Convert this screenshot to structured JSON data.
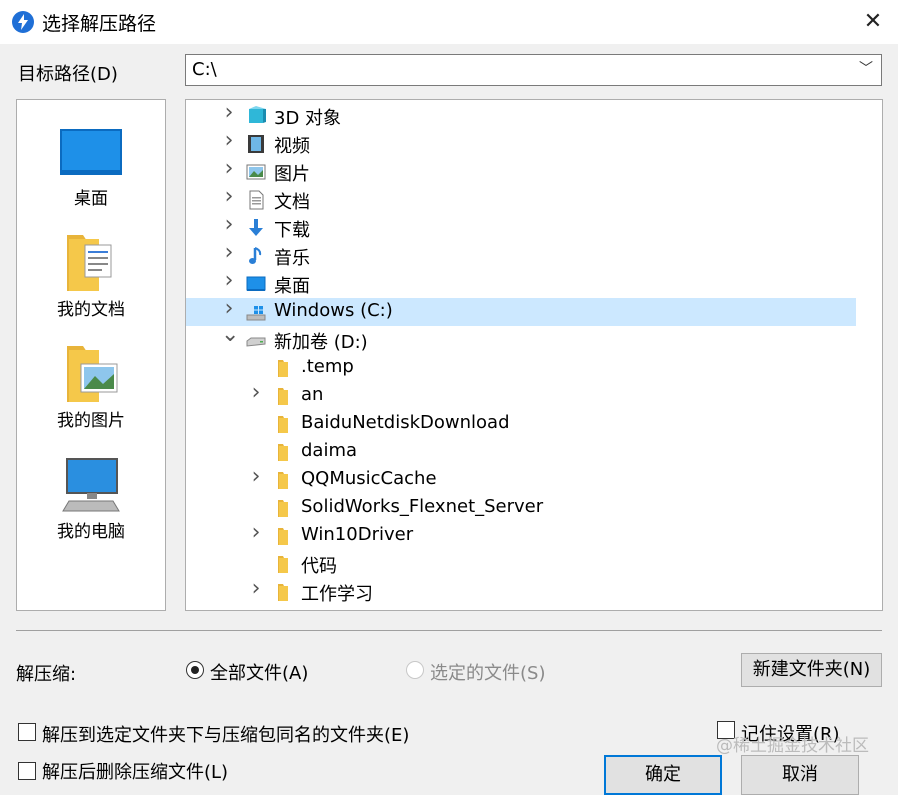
{
  "window": {
    "title": "选择解压路径",
    "close_icon": "✕"
  },
  "path": {
    "label": "目标路径(D)",
    "value": "C:\\",
    "dropdown_icon": "﹀"
  },
  "quick_access": [
    {
      "label": "桌面",
      "icon": "desktop-icon"
    },
    {
      "label": "我的文档",
      "icon": "documents-folder-icon"
    },
    {
      "label": "我的图片",
      "icon": "pictures-folder-icon"
    },
    {
      "label": "我的电脑",
      "icon": "computer-icon"
    }
  ],
  "tree": {
    "items": [
      {
        "label": "3D 对象",
        "icon": "3d-objects-icon",
        "chevron": ">"
      },
      {
        "label": "视频",
        "icon": "videos-icon",
        "chevron": ">"
      },
      {
        "label": "图片",
        "icon": "pictures-icon",
        "chevron": ">"
      },
      {
        "label": "文档",
        "icon": "documents-icon",
        "chevron": ">"
      },
      {
        "label": "下载",
        "icon": "downloads-icon",
        "chevron": ">"
      },
      {
        "label": "音乐",
        "icon": "music-icon",
        "chevron": ">"
      },
      {
        "label": "桌面",
        "icon": "desktop-icon",
        "chevron": ">"
      },
      {
        "label": "Windows (C:)",
        "icon": "windows-drive-icon",
        "chevron": ">",
        "selected": true
      },
      {
        "label": "新加卷 (D:)",
        "icon": "drive-icon",
        "chevron": "v"
      },
      {
        "label": ".temp",
        "icon": "folder-icon",
        "chevron": ""
      },
      {
        "label": "an",
        "icon": "folder-icon",
        "chevron": ">"
      },
      {
        "label": "BaiduNetdiskDownload",
        "icon": "folder-icon",
        "chevron": ""
      },
      {
        "label": "daima",
        "icon": "folder-icon",
        "chevron": ""
      },
      {
        "label": "QQMusicCache",
        "icon": "folder-icon",
        "chevron": ">"
      },
      {
        "label": "SolidWorks_Flexnet_Server",
        "icon": "folder-icon",
        "chevron": ""
      },
      {
        "label": "Win10Driver",
        "icon": "folder-icon",
        "chevron": ">"
      },
      {
        "label": "代码",
        "icon": "folder-icon",
        "chevron": ""
      },
      {
        "label": "工作学习",
        "icon": "folder-icon",
        "chevron": ">"
      }
    ]
  },
  "scrollbar": {
    "up_icon": "︿",
    "down_icon": "﹀"
  },
  "extract": {
    "label": "解压缩:",
    "all_files_label": "全部文件(A)",
    "all_files_checked": true,
    "selected_files_label": "选定的文件(S)",
    "selected_files_enabled": false,
    "new_folder_button": "新建文件夹(N)"
  },
  "options": {
    "extract_to_same_name_label": "解压到选定文件夹下与压缩包同名的文件夹(E)",
    "remember_settings_label": "记住设置(R)",
    "delete_after_label": "解压后删除压缩文件(L)"
  },
  "buttons": {
    "ok": "确定",
    "cancel": "取消"
  },
  "watermark": "@稀土掘金技术社区",
  "colors": {
    "selection": "#cce8ff",
    "accent": "#0078d7",
    "folder": "#f5c84a"
  }
}
